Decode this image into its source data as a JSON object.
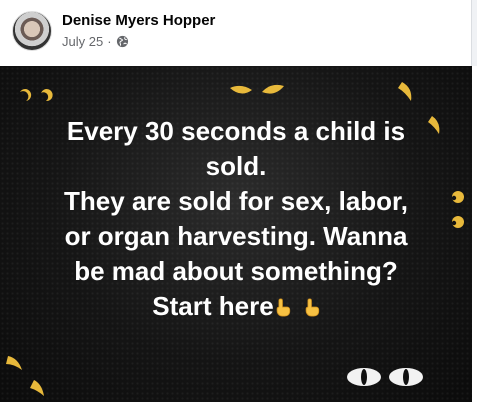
{
  "post": {
    "author": "Denise Myers Hopper",
    "date": "July 25",
    "separator": "·",
    "privacy_icon": "globe-icon",
    "message_lines": [
      "Every 30 seconds a child is",
      "sold.",
      "They are sold for sex, labor,",
      "or organ harvesting. Wanna",
      "be mad about something?",
      "Start here"
    ],
    "emojis": [
      "index-pointing-up-emoji",
      "index-pointing-up-emoji"
    ],
    "background_color": "#151515",
    "eye_color": "#e8b93b"
  }
}
